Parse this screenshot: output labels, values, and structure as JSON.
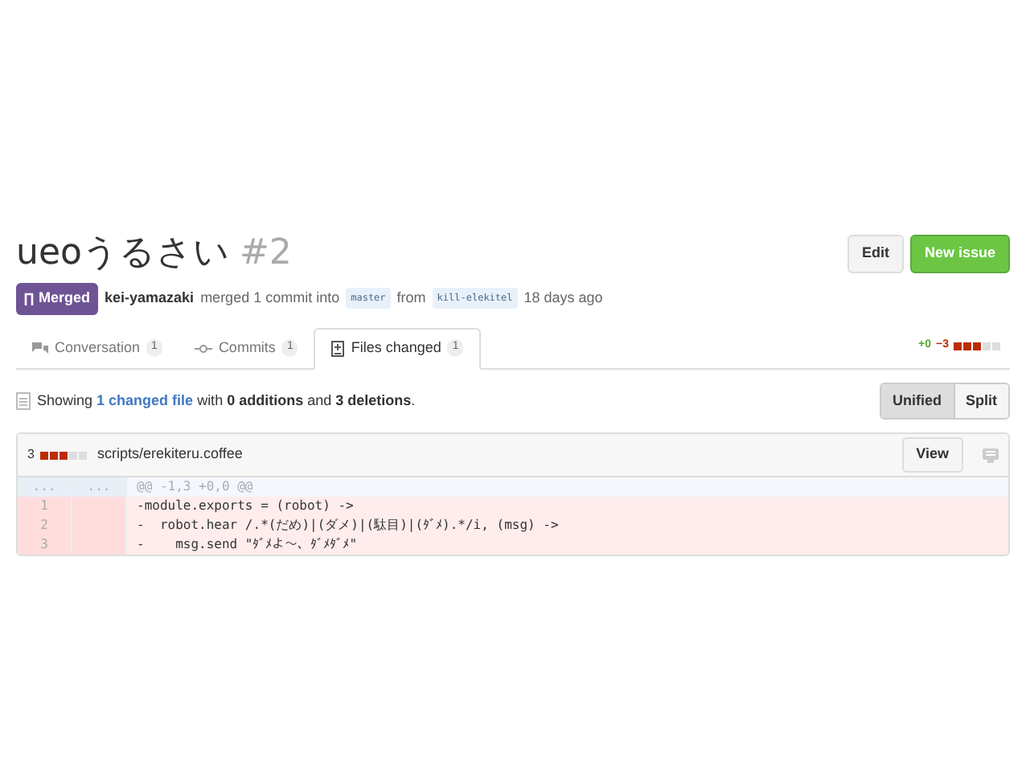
{
  "title": {
    "text": "ueoうるさい",
    "number": "#2"
  },
  "header_buttons": [
    {
      "label": "Edit",
      "kind": "plain"
    },
    {
      "label": "New issue",
      "kind": "primary"
    }
  ],
  "state_badge": "Merged",
  "meta": {
    "author": "kei-yamazaki",
    "action": "merged 1 commit into",
    "base": "master",
    "from": "from",
    "head": "kill-elekitel",
    "time": "18 days ago"
  },
  "tabs": [
    {
      "label": "Conversation",
      "count": "1",
      "selected": false
    },
    {
      "label": "Commits",
      "count": "1",
      "selected": false
    },
    {
      "label": "Files changed",
      "count": "1",
      "selected": true
    }
  ],
  "diffstat": {
    "additions": "+0",
    "deletions": "−3",
    "blocks": [
      {
        "color": "#bd2c00"
      },
      {
        "color": "#bd2c00"
      },
      {
        "color": "#bd2c00"
      },
      {
        "color": "#dddddd"
      },
      {
        "color": "#dddddd"
      }
    ]
  },
  "summary": "Showing **1 changed file** with **0 additions** and **3 deletions**.",
  "view_toggle": [
    {
      "label": "Unified",
      "selected": true
    },
    {
      "label": "Split",
      "selected": false
    }
  ],
  "file": {
    "count": "3",
    "blocks": [
      {
        "color": "#bd2c00"
      },
      {
        "color": "#bd2c00"
      },
      {
        "color": "#bd2c00"
      },
      {
        "color": "#dddddd"
      },
      {
        "color": "#dddddd"
      }
    ],
    "path": "scripts/erekiteru.coffee",
    "view_button": "View",
    "lines": [
      {
        "kind": "hunk",
        "old": "...",
        "new": "...",
        "code": "@@ -1,3 +0,0 @@"
      },
      {
        "kind": "deleted",
        "old": "1",
        "code": "-module.exports = (robot) ->"
      },
      {
        "kind": "deleted",
        "old": "2",
        "code": "-  robot.hear /.*(だめ)|(ダメ)|(駄目)|(ﾀﾞﾒ).*/i, (msg) ->"
      },
      {
        "kind": "deleted",
        "old": "3",
        "code": "-    msg.send \"ﾀﾞﾒよ～、ﾀﾞﾒﾀﾞﾒ\""
      }
    ]
  }
}
